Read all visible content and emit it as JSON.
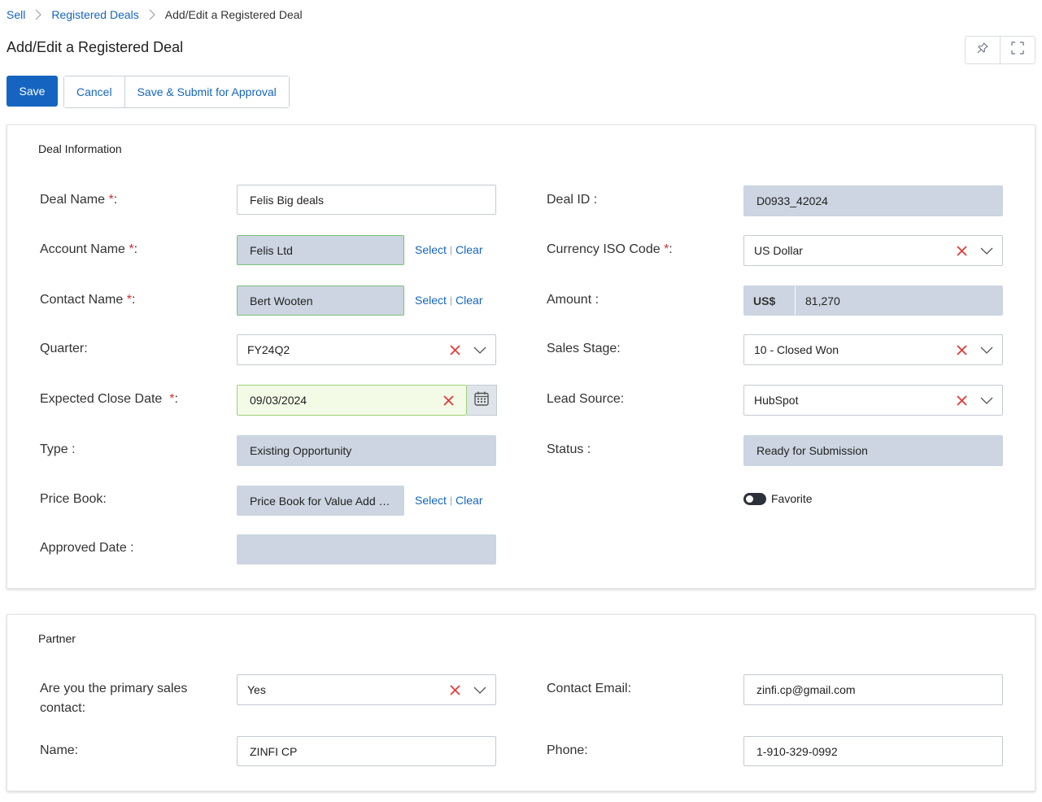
{
  "breadcrumb": {
    "items": [
      "Sell",
      "Registered Deals"
    ],
    "current": "Add/Edit a Registered Deal"
  },
  "page": {
    "title": "Add/Edit a Registered Deal"
  },
  "toolbar": {
    "save_label": "Save",
    "cancel_label": "Cancel",
    "submit_label": "Save & Submit for Approval"
  },
  "deal": {
    "section_title": "Deal Information",
    "deal_name": {
      "label": "Deal Name",
      "value": "Felis Big deals"
    },
    "account_name": {
      "label": "Account Name",
      "value": "Felis Ltd"
    },
    "contact_name": {
      "label": "Contact Name",
      "value": "Bert Wooten"
    },
    "quarter": {
      "label": "Quarter:",
      "value": "FY24Q2"
    },
    "close_date": {
      "label": "Expected Close Date",
      "value": "09/03/2024"
    },
    "type": {
      "label": "Type :",
      "value": "Existing Opportunity"
    },
    "price_book": {
      "label": "Price Book:",
      "value": "Price Book for Value Add Reseller"
    },
    "approved_date": {
      "label": "Approved Date :",
      "value": ""
    },
    "deal_id": {
      "label": "Deal ID :",
      "value": "D0933_42024"
    },
    "currency": {
      "label": "Currency ISO Code",
      "value": "US Dollar"
    },
    "amount": {
      "label": "Amount :",
      "prefix": "US$",
      "value": "81,270"
    },
    "sales_stage": {
      "label": "Sales Stage:",
      "value": "10 - Closed Won"
    },
    "lead_source": {
      "label": "Lead Source:",
      "value": "HubSpot"
    },
    "status": {
      "label": "Status :",
      "value": "Ready for Submission"
    },
    "favorite": {
      "label": "Favorite"
    }
  },
  "partner": {
    "section_title": "Partner",
    "primary_contact": {
      "label": "Are you the primary sales contact:",
      "value": "Yes"
    },
    "name": {
      "label": "Name:",
      "value": "ZINFI CP"
    },
    "email": {
      "label": "Contact Email:",
      "value": "zinfi.cp@gmail.com"
    },
    "phone": {
      "label": "Phone:",
      "value": "1-910-329-0992"
    }
  },
  "common": {
    "select_label": "Select",
    "clear_label": "Clear",
    "required_mark": "*",
    "label_colon": ":"
  },
  "colors": {
    "primary": "#1565c0",
    "readonly_bg": "#ccd5e1",
    "clear_icon": "#e53935"
  },
  "icons": [
    "chevron-right-icon",
    "pin-icon",
    "fullscreen-icon",
    "close-icon",
    "chevron-down-icon",
    "calendar-icon"
  ]
}
